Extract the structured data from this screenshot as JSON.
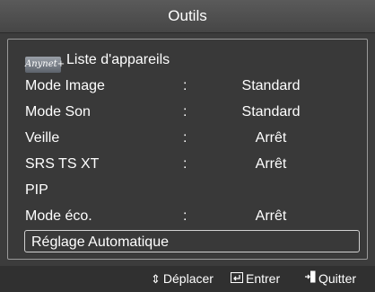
{
  "title": "Outils",
  "menu": {
    "rows": [
      {
        "label": "Liste d'appareils",
        "icon": "anynet-logo-icon",
        "icon_text": "Anynet+",
        "sep": "",
        "value": ""
      },
      {
        "label": "Mode Image",
        "sep": ":",
        "value": "Standard"
      },
      {
        "label": "Mode Son",
        "sep": ":",
        "value": "Standard"
      },
      {
        "label": "Veille",
        "sep": ":",
        "value": "Arrêt"
      },
      {
        "label": "SRS TS XT",
        "sep": ":",
        "value": "Arrêt"
      },
      {
        "label": "PIP",
        "sep": "",
        "value": ""
      },
      {
        "label": "Mode éco.",
        "sep": ":",
        "value": "Arrêt"
      },
      {
        "label": "Réglage Automatique",
        "sep": "",
        "value": "",
        "selected": true
      }
    ]
  },
  "footer": {
    "move_label": "Déplacer",
    "move_icon": "up-down-arrows-icon",
    "enter_label": "Entrer",
    "enter_icon": "enter-icon",
    "exit_label": "Quitter",
    "exit_icon": "exit-door-icon"
  }
}
